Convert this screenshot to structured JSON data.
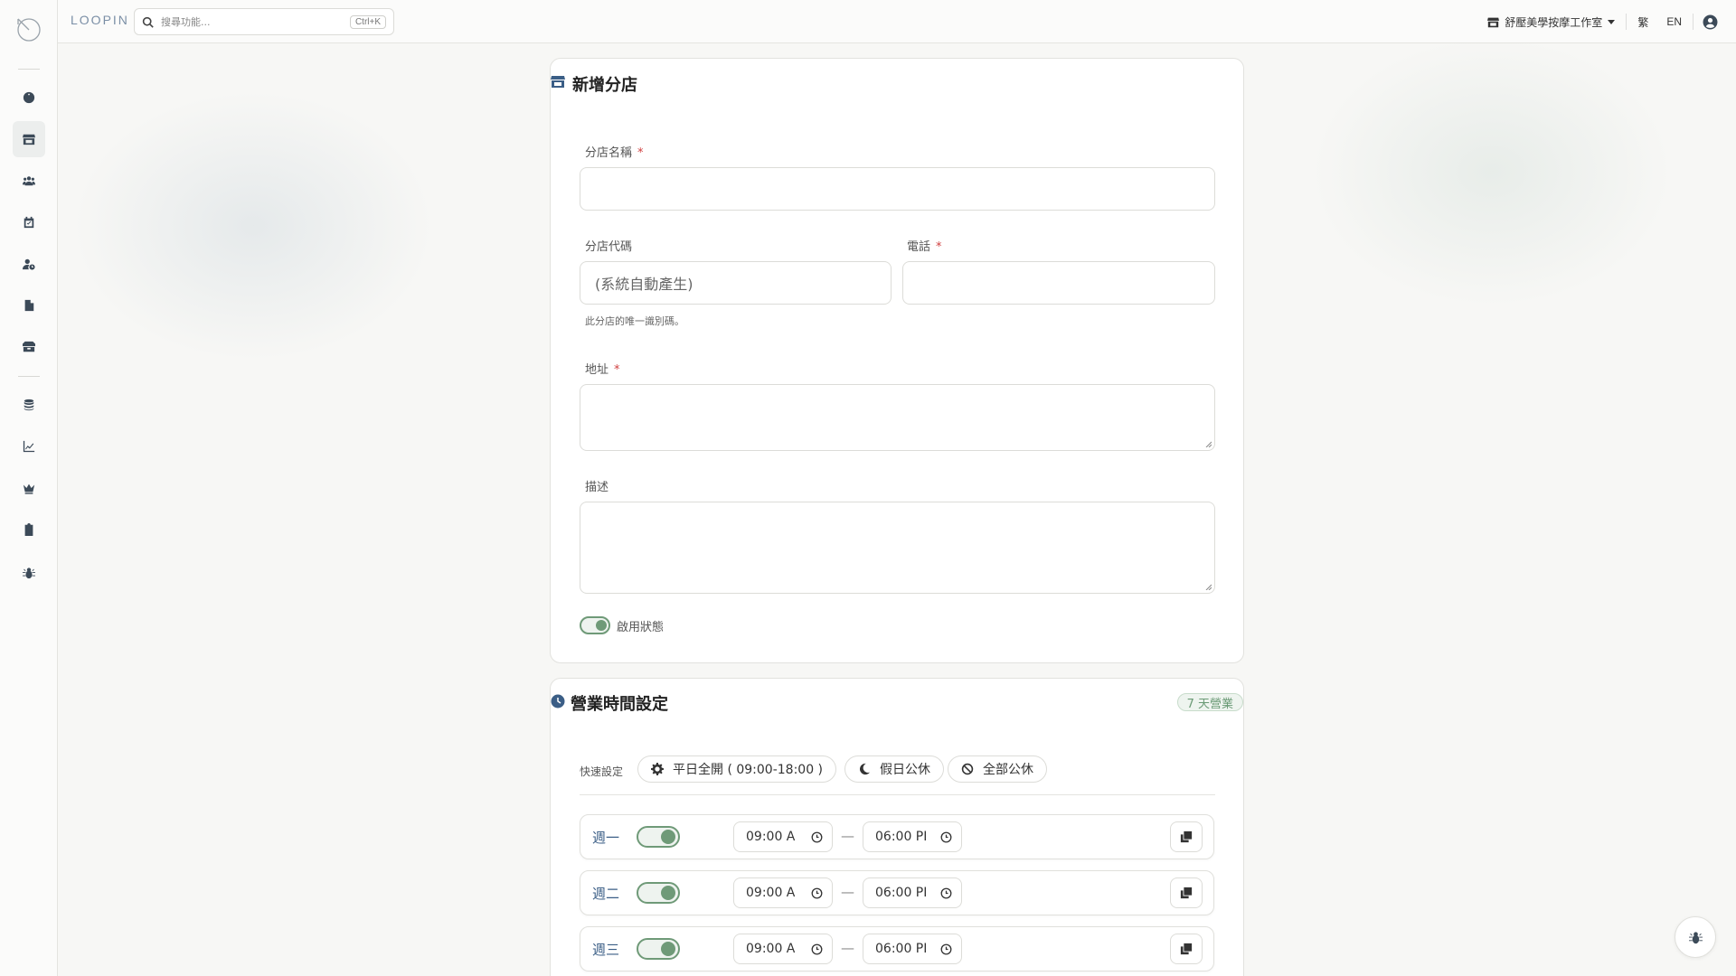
{
  "header": {
    "brand": "LOOPIN",
    "search_placeholder": "搜尋功能...",
    "search_shortcut": "Ctrl+K",
    "store_name": "舒壓美學按摩工作室",
    "lang_zh": "繁",
    "lang_en": "EN"
  },
  "sidebar": {
    "items": [
      {
        "icon": "dashboard-icon"
      },
      {
        "icon": "store-icon",
        "active": true
      },
      {
        "icon": "users-icon"
      },
      {
        "icon": "calendar-check-icon"
      },
      {
        "icon": "user-clock-icon"
      },
      {
        "icon": "file-icon"
      },
      {
        "icon": "box-icon"
      },
      {
        "icon": "coins-icon"
      },
      {
        "icon": "chart-line-icon"
      },
      {
        "icon": "crown-icon"
      },
      {
        "icon": "clipboard-icon"
      },
      {
        "icon": "bug-icon"
      }
    ]
  },
  "form": {
    "title": "新增分店",
    "name_label": "分店名稱",
    "code_label": "分店代碼",
    "code_placeholder": "(系統自動產生)",
    "code_hint": "此分店的唯一識別碼。",
    "phone_label": "電話",
    "address_label": "地址",
    "description_label": "描述",
    "active_label": "啟用狀態",
    "required_mark": "*"
  },
  "hours": {
    "title": "營業時間設定",
    "badge": "7 天營業",
    "quick_label": "快速設定",
    "quick_weekday": "平日全開 ( 09:00-18:00 )",
    "quick_holiday": "假日公休",
    "quick_all_closed": "全部公休",
    "separator": "—",
    "days": [
      {
        "name": "週一",
        "open": "09:00 A",
        "close": "06:00 PI"
      },
      {
        "name": "週二",
        "open": "09:00 A",
        "close": "06:00 PI"
      },
      {
        "name": "週三",
        "open": "09:00 A",
        "close": "06:00 PI"
      }
    ]
  },
  "colors": {
    "accent_green": "#6f9a78",
    "day_blue": "#3b5e86",
    "required_red": "#d04040"
  }
}
